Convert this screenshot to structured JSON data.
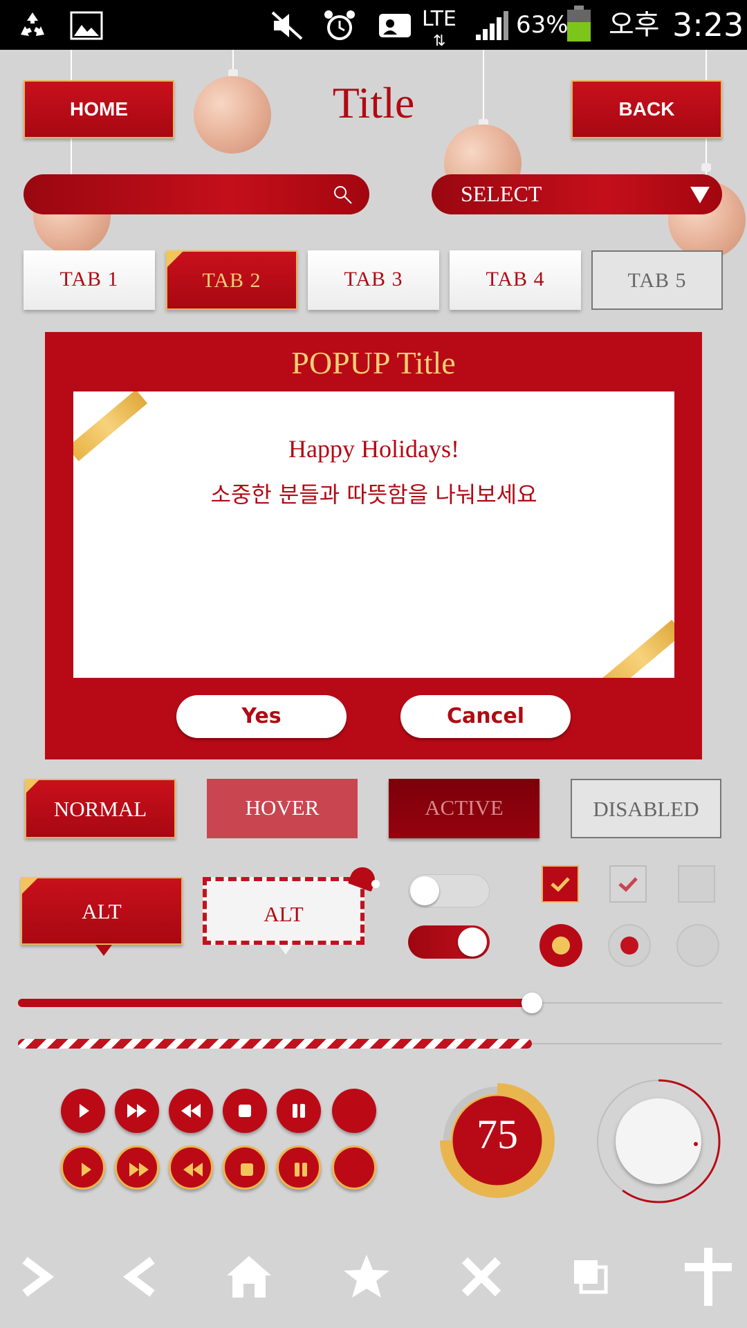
{
  "status_bar": {
    "network": "LTE",
    "battery": "63%",
    "ampm": "오후",
    "time": "3:23",
    "icons": [
      "recycle-icon",
      "image-icon",
      "mute-icon",
      "alarm-icon",
      "contact-card-icon",
      "signal-icon",
      "battery-icon"
    ]
  },
  "header": {
    "home_label": "HOME",
    "title": "Title",
    "back_label": "BACK"
  },
  "search": {
    "placeholder": "",
    "icon": "search-icon"
  },
  "select": {
    "label": "SELECT",
    "icon": "dropdown-triangle-icon"
  },
  "tabs": [
    {
      "label": "TAB 1",
      "state": "normal"
    },
    {
      "label": "TAB 2",
      "state": "active"
    },
    {
      "label": "TAB 3",
      "state": "normal"
    },
    {
      "label": "TAB 4",
      "state": "normal"
    },
    {
      "label": "TAB 5",
      "state": "disabled"
    }
  ],
  "popup": {
    "title": "POPUP Title",
    "line1": "Happy Holidays!",
    "line2": "소중한 분들과 따뜻함을 나눠보세요",
    "yes_label": "Yes",
    "cancel_label": "Cancel"
  },
  "state_buttons": [
    {
      "label": "NORMAL"
    },
    {
      "label": "HOVER"
    },
    {
      "label": "ACTIVE"
    },
    {
      "label": "DISABLED"
    }
  ],
  "bubbles": [
    {
      "label": "ALT"
    },
    {
      "label": "ALT"
    }
  ],
  "toggles": [
    {
      "on": false
    },
    {
      "on": true
    }
  ],
  "checkboxes": [
    {
      "state": "checked-active"
    },
    {
      "state": "checked-hover"
    },
    {
      "state": "disabled"
    }
  ],
  "radios": [
    {
      "state": "selected-active"
    },
    {
      "state": "selected-hover"
    },
    {
      "state": "disabled"
    }
  ],
  "slider": {
    "value_fraction": 0.73
  },
  "progress": {
    "value_fraction": 0.73
  },
  "media_controls": {
    "row1": [
      "play-icon",
      "fast-forward-icon",
      "rewind-icon",
      "stop-icon",
      "pause-icon",
      "blank-icon"
    ],
    "row2": [
      "play-icon",
      "fast-forward-icon",
      "rewind-icon",
      "stop-icon",
      "pause-icon",
      "blank-icon"
    ]
  },
  "gauge": {
    "value": "75",
    "fraction": 0.75
  },
  "dial": {
    "fraction": 0.6
  },
  "nav_icons": [
    "chevron-right-icon",
    "chevron-left-icon",
    "home-icon",
    "star-icon",
    "close-icon",
    "copy-icon",
    "plus-icon"
  ],
  "colors": {
    "brand_red": "#b80a16",
    "gold": "#f3cd76",
    "background": "#d4d4d4"
  }
}
